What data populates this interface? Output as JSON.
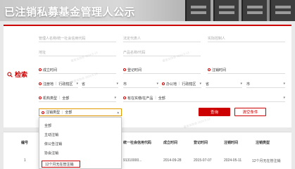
{
  "page": {
    "title": "已注销私募基金管理人公示",
    "search_label": "检索"
  },
  "form": {
    "manager_name_placeholder": "管理人名称/统一社会信用代码",
    "legal_rep_placeholder": "法定代表人",
    "actual_controller_placeholder": "实际控制人",
    "address_placeholder": "地址",
    "product_name_placeholder": "产品名称/代码",
    "established_time_label": "成立时间",
    "registered_time_label": "登记时间",
    "deregistered_time_label": "注销时间",
    "registered_address_label": "注册地",
    "registered_address_value": "行政辖区",
    "province_label": "省",
    "city_label": "市",
    "office_address_label": "办公地",
    "office_address_value": "行政辖区",
    "office_province_label": "省",
    "office_city_label": "市",
    "org_type_label": "机构类型",
    "org_type_value": "全部",
    "unfinished_product_label": "有在实缴/在产品",
    "unfinished_product_value": "全部",
    "deregistration_type_label": "注销类型",
    "deregistration_type_value": "全部"
  },
  "buttons": {
    "search": "查询",
    "clear": "清空条件"
  },
  "dropdown": {
    "options": [
      "全部",
      "主动注销",
      "依公告注销",
      "协会注销",
      "12个月无在管注销"
    ],
    "selected_index": 4
  },
  "table": {
    "headers": [
      "编号",
      "私募基金管理人名称",
      "统一社会信用代码",
      "成立时间",
      "登记时间",
      "注销时间",
      "注销类型"
    ],
    "row": [
      "1",
      "",
      "91310000...",
      "2014-09-28",
      "2015-07-07",
      "2024-05-11",
      "12个月无在管注销"
    ]
  },
  "watermark": "基金业协会 2024-5-13"
}
